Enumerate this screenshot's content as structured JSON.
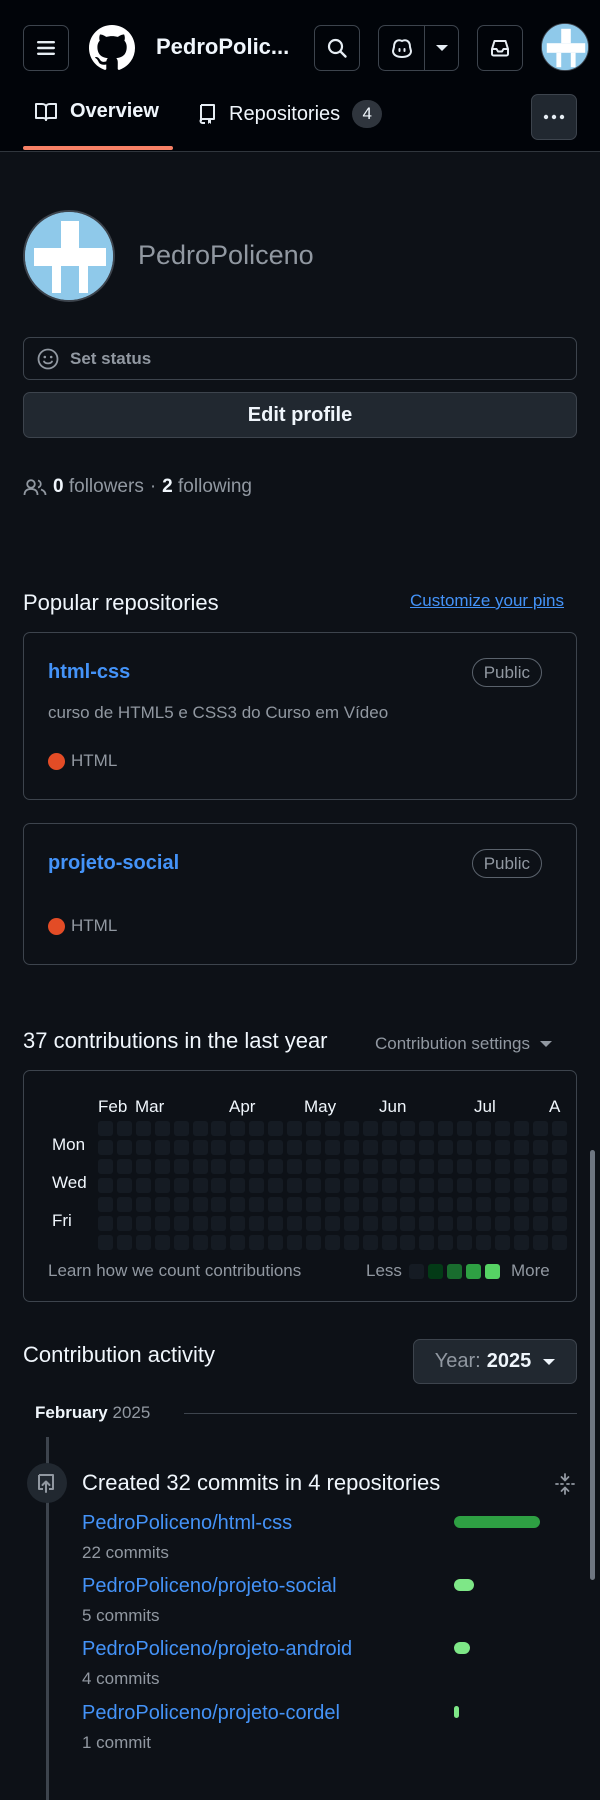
{
  "header": {
    "username": "PedroPolic...",
    "icons": [
      "hamburger-menu-icon",
      "github-logo-icon",
      "search-icon",
      "copilot-icon",
      "chevron-down-icon",
      "inbox-icon",
      "more-horizontal-icon"
    ],
    "tabs": [
      {
        "label": "Overview",
        "icon": "book-icon",
        "selected": true
      },
      {
        "label": "Repositories",
        "icon": "repo-icon",
        "count": "4"
      }
    ]
  },
  "profile": {
    "name": "PedroPoliceno",
    "status_label": "Set status",
    "edit_label": "Edit profile",
    "followers_count": "0",
    "followers_label": "followers",
    "separator": "·",
    "following_count": "2",
    "following_label": "following"
  },
  "popular": {
    "title": "Popular repositories",
    "customize_label": "Customize your pins",
    "repos": [
      {
        "name": "html-css",
        "visibility": "Public",
        "description": "curso de HTML5 e CSS3 do Curso em Vídeo",
        "language": "HTML",
        "language_color": "#e34c26"
      },
      {
        "name": "projeto-social",
        "visibility": "Public",
        "description": "",
        "language": "HTML",
        "language_color": "#e34c26"
      }
    ]
  },
  "contributions": {
    "title": "37 contributions in the last year",
    "settings_label": "Contribution settings",
    "months": [
      "Feb",
      "Mar",
      "Apr",
      "May",
      "Jun",
      "Jul",
      "A"
    ],
    "days": [
      "Mon",
      "Wed",
      "Fri"
    ],
    "learn_label": "Learn how we count contributions",
    "less_label": "Less",
    "more_label": "More",
    "legend_colors": [
      "#151b23",
      "#033a16",
      "#196c2e",
      "#2ea043",
      "#56d364"
    ]
  },
  "activity": {
    "title": "Contribution activity",
    "year_label": "Year:",
    "year_value": "2025",
    "month_label": "February",
    "month_year": "2025",
    "summary": "Created 32 commits in 4 repositories",
    "repos": [
      {
        "name": "PedroPoliceno/html-css",
        "count_label": "22 commits",
        "commits": 22,
        "bar_color": "#2ea043"
      },
      {
        "name": "PedroPoliceno/projeto-social",
        "count_label": "5 commits",
        "commits": 5,
        "bar_color": "#7ee787"
      },
      {
        "name": "PedroPoliceno/projeto-android",
        "count_label": "4 commits",
        "commits": 4,
        "bar_color": "#7ee787"
      },
      {
        "name": "PedroPoliceno/projeto-cordel",
        "count_label": "1 commit",
        "commits": 1,
        "bar_color": "#7ee787"
      }
    ]
  }
}
